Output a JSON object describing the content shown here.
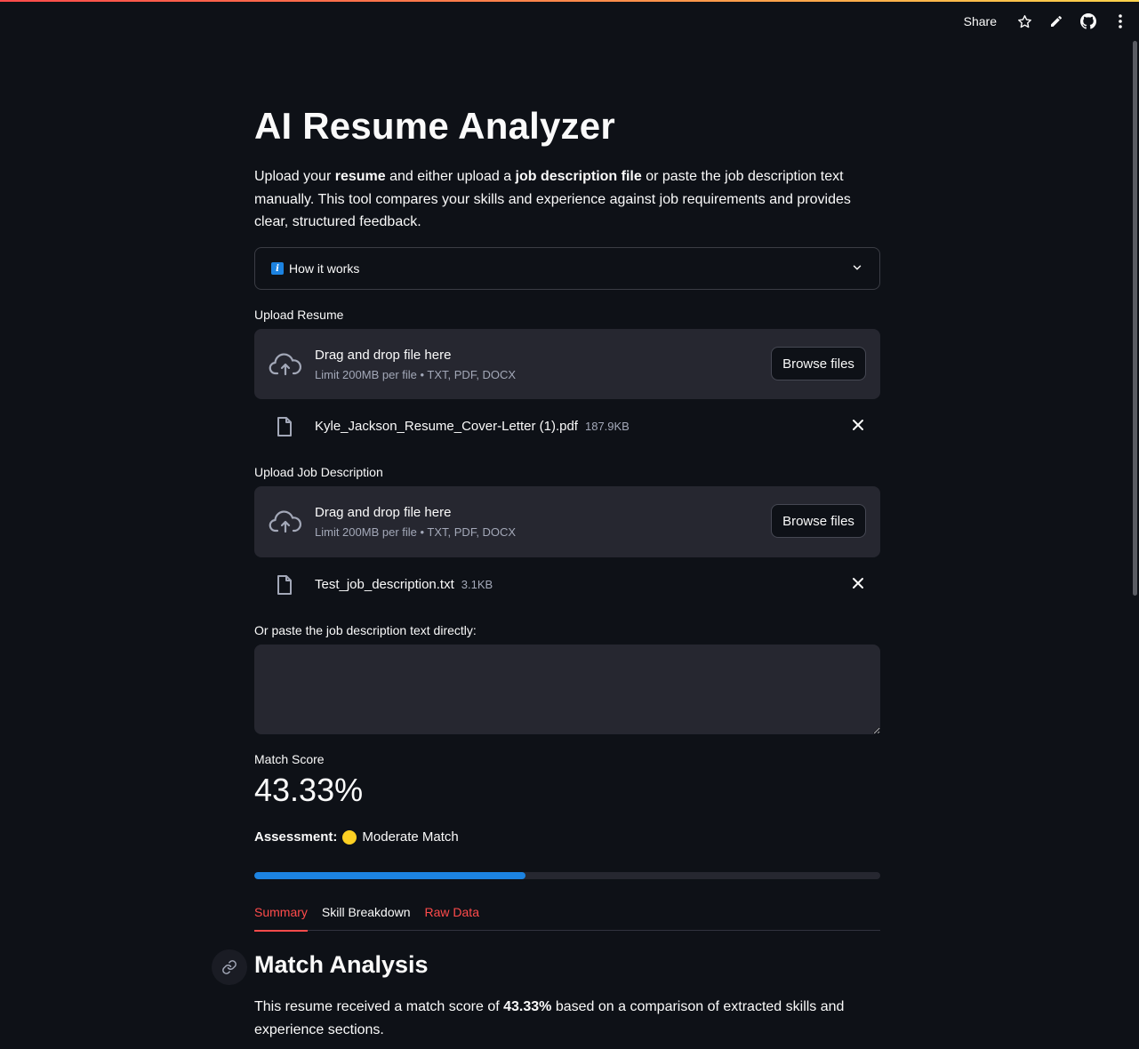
{
  "toolbar": {
    "share_label": "Share"
  },
  "page": {
    "title": "AI Resume Analyzer",
    "intro": {
      "p1": "Upload your ",
      "b1": "resume",
      "p2": " and either upload a ",
      "b2": "job description file",
      "p3": " or paste the job description text manually. This tool compares your skills and experience against job requirements and provides clear, structured feedback."
    }
  },
  "expander": {
    "label": "How it works",
    "icon": "info-icon"
  },
  "resume_upload": {
    "label": "Upload Resume",
    "drop_text": "Drag and drop file here",
    "limit_text": "Limit 200MB per file • TXT, PDF, DOCX",
    "browse_label": "Browse files",
    "file": {
      "name": "Kyle_Jackson_Resume_Cover-Letter (1).pdf",
      "size": "187.9KB"
    }
  },
  "jd_upload": {
    "label": "Upload Job Description",
    "drop_text": "Drag and drop file here",
    "limit_text": "Limit 200MB per file • TXT, PDF, DOCX",
    "browse_label": "Browse files",
    "file": {
      "name": "Test_job_description.txt",
      "size": "3.1KB"
    }
  },
  "jd_text": {
    "label": "Or paste the job description text directly:",
    "value": ""
  },
  "metric": {
    "label": "Match Score",
    "value": "43.33%"
  },
  "assessment": {
    "label": "Assessment:",
    "value": "Moderate Match",
    "dot_color": "#fdd023"
  },
  "progress": {
    "fraction": 0.4333,
    "color": "#1c83e1"
  },
  "tabs": [
    {
      "label": "Summary"
    },
    {
      "label": "Skill Breakdown"
    },
    {
      "label": "Raw Data"
    }
  ],
  "analysis": {
    "heading": "Match Analysis",
    "t1": "This resume received a match score of ",
    "score": "43.33%",
    "t2": " based on a comparison of extracted skills and experience sections."
  },
  "colors": {
    "background": "#0e1117",
    "accent": "#ff4b4b",
    "progress": "#1c83e1"
  }
}
